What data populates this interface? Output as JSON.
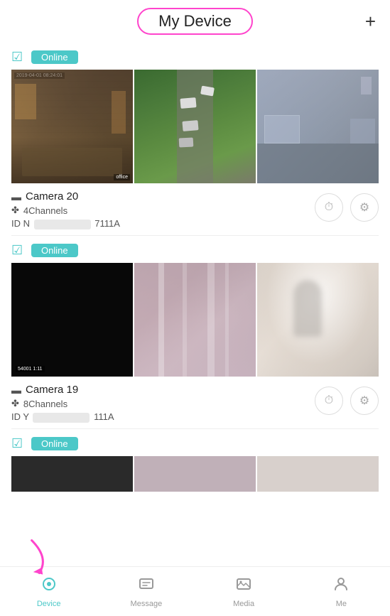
{
  "header": {
    "title": "My Device",
    "add_button": "+"
  },
  "devices": [
    {
      "id": "device-1",
      "status": "Online",
      "name": "Camera 20",
      "channels": "4Channels",
      "device_id_prefix": "ID N",
      "device_id_suffix": "7111A",
      "cameras": [
        {
          "id": "cam1",
          "type": "indoor-store",
          "timestamp": "2019-04-01 08:24:01",
          "label": "office"
        },
        {
          "id": "cam2",
          "type": "parking-aerial",
          "label": ""
        },
        {
          "id": "cam3",
          "type": "office",
          "label": ""
        }
      ]
    },
    {
      "id": "device-2",
      "status": "Online",
      "name": "Camera 19",
      "channels": "8Channels",
      "device_id_prefix": "ID Y",
      "device_id_suffix": "111A",
      "cameras": [
        {
          "id": "cam4",
          "type": "dark",
          "label": "54001 1:11"
        },
        {
          "id": "cam5",
          "type": "blurred-pink",
          "label": ""
        },
        {
          "id": "cam6",
          "type": "blurred-light",
          "label": ""
        }
      ]
    },
    {
      "id": "device-3",
      "status": "Online",
      "name": "",
      "channels": "",
      "device_id_prefix": "",
      "device_id_suffix": "",
      "cameras": []
    }
  ],
  "bottom_nav": {
    "items": [
      {
        "id": "device",
        "label": "Device",
        "active": true
      },
      {
        "id": "message",
        "label": "Message",
        "active": false
      },
      {
        "id": "media",
        "label": "Media",
        "active": false
      },
      {
        "id": "me",
        "label": "Me",
        "active": false
      }
    ]
  },
  "icons": {
    "checkmark": "☑",
    "camera_icon": "▬",
    "channels_icon": "✤",
    "history_icon": "⏱",
    "settings_icon": "⚙",
    "device_nav": "◎",
    "message_nav": "💬",
    "media_nav": "🖼",
    "me_nav": "👤",
    "add": "+",
    "arrow": "➜"
  }
}
